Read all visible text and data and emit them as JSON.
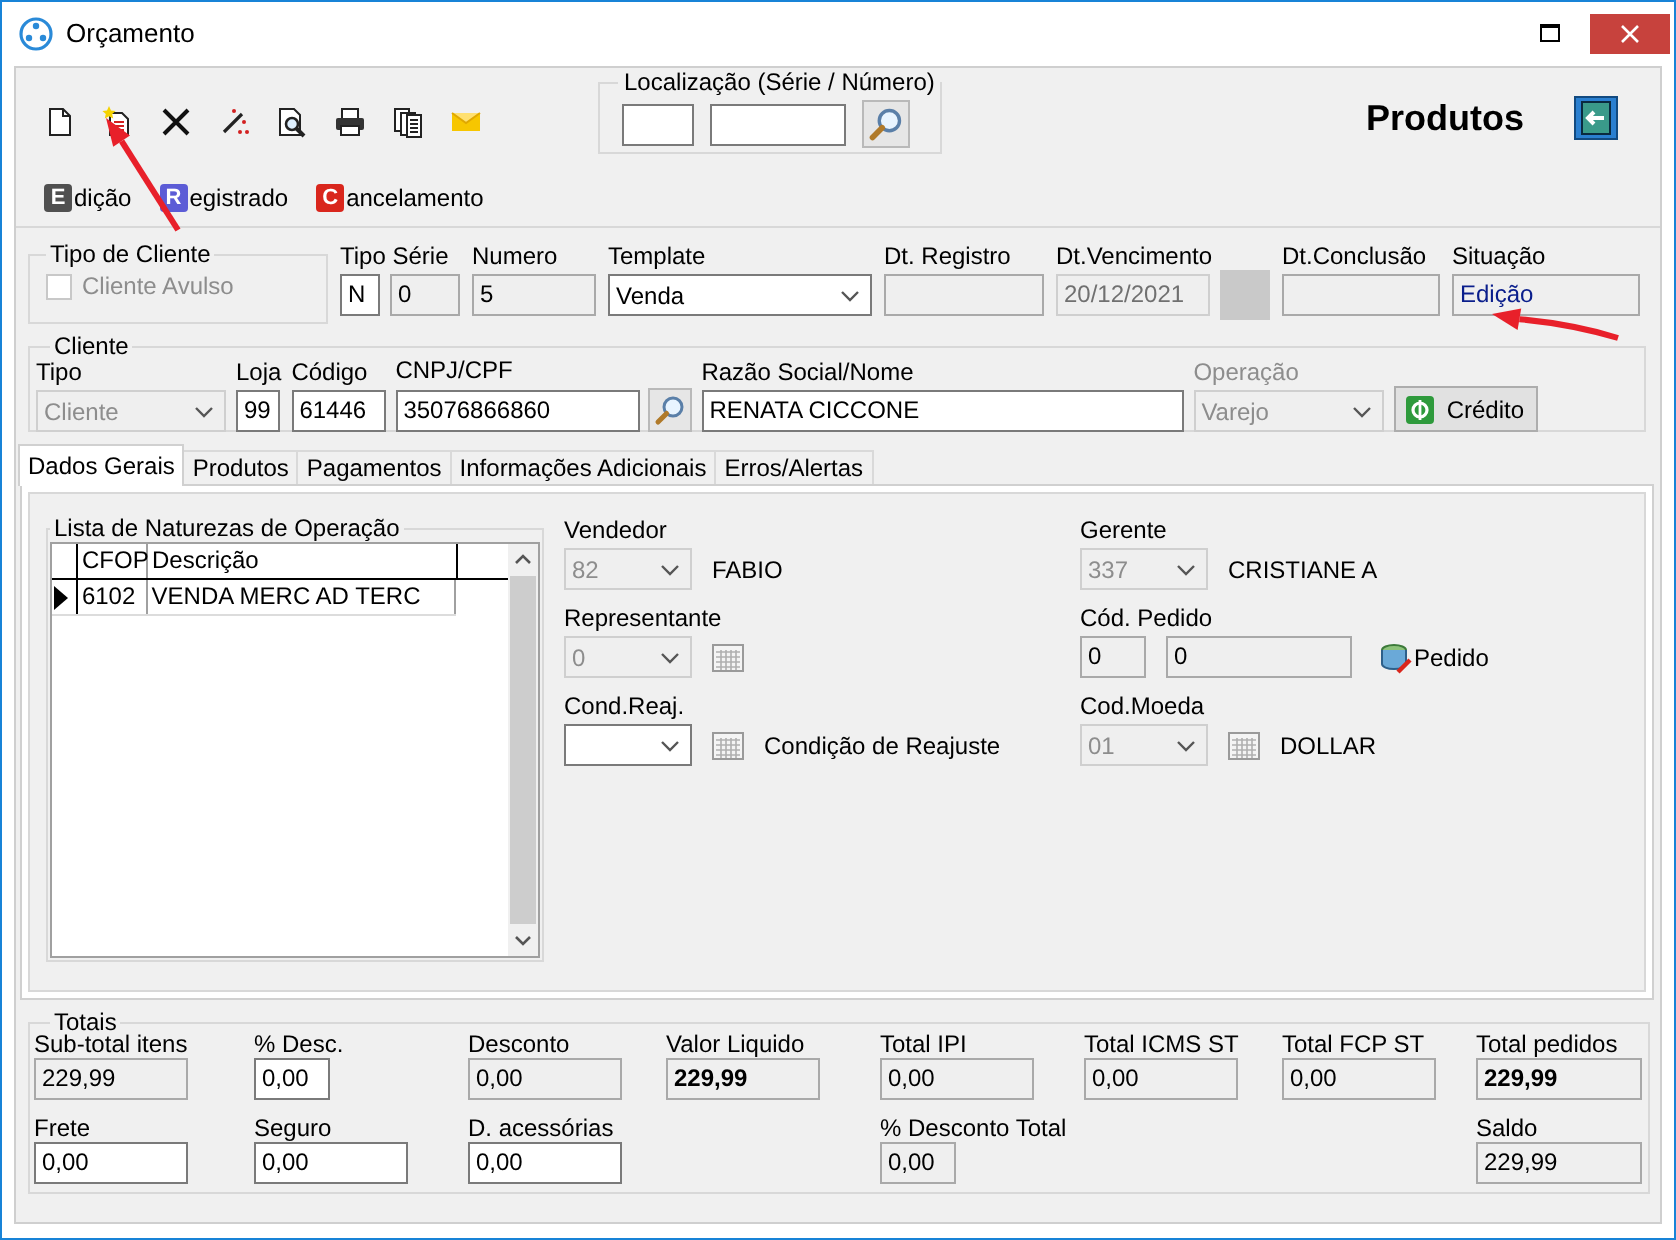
{
  "window": {
    "title": "Orçamento"
  },
  "toolbar": {
    "locator": {
      "title": "Localização (Série / Número)"
    },
    "heading": "Produtos"
  },
  "status_options": [
    {
      "letter": "E",
      "label": "dição",
      "color": "#505050"
    },
    {
      "letter": "R",
      "label": "egistrado",
      "color": "#5c5cd6"
    },
    {
      "letter": "C",
      "label": "ancelamento",
      "color": "#d9261c"
    }
  ],
  "client_type": {
    "title": "Tipo de Cliente",
    "checkbox": {
      "label": "Cliente Avulso",
      "checked": false,
      "disabled": true
    }
  },
  "header_fields": [
    {
      "label": "Tipo Série",
      "controls": [
        {
          "kind": "input",
          "value": "N",
          "readonly": false,
          "disabled": false
        },
        {
          "kind": "input",
          "value": "0",
          "readonly": true,
          "disabled": false
        }
      ]
    },
    {
      "label": "Numero",
      "controls": [
        {
          "kind": "input",
          "value": "5",
          "readonly": true,
          "disabled": false
        }
      ]
    },
    {
      "label": "Template",
      "controls": [
        {
          "kind": "select",
          "value": "Venda",
          "disabled": false
        }
      ]
    },
    {
      "label": "Dt. Registro",
      "controls": [
        {
          "kind": "input",
          "readonly": true,
          "disabled": false
        }
      ]
    },
    {
      "label": "Dt.Vencimento",
      "controls": [
        {
          "kind": "input",
          "value": "20/12/2021",
          "disabled": true
        },
        {
          "kind": "swatch"
        }
      ]
    },
    {
      "label": "Dt.Conclusão",
      "controls": [
        {
          "kind": "input",
          "readonly": true,
          "disabled": false
        }
      ]
    },
    {
      "label": "Situação",
      "controls": [
        {
          "kind": "status",
          "value": "Edição",
          "readonly": true,
          "disabled": false
        }
      ]
    }
  ],
  "client": {
    "title": "Cliente",
    "fields": [
      {
        "label": "Tipo",
        "label_disabled": false,
        "controls": [
          {
            "kind": "select",
            "value": "Cliente",
            "disabled": true
          }
        ]
      },
      {
        "label": "Loja",
        "label_disabled": false,
        "controls": [
          {
            "kind": "input",
            "value": "99",
            "readonly": false,
            "disabled": false
          }
        ]
      },
      {
        "label": "Código",
        "label_disabled": false,
        "controls": [
          {
            "kind": "input",
            "value": "61446",
            "readonly": false,
            "disabled": false
          }
        ]
      },
      {
        "label": "CNPJ/CPF",
        "label_disabled": false,
        "controls": [
          {
            "kind": "input",
            "value": "35076866860",
            "readonly": false,
            "disabled": false
          },
          {
            "kind": "search"
          }
        ]
      },
      {
        "label": "Razão Social/Nome",
        "label_disabled": false,
        "controls": [
          {
            "kind": "input",
            "value": "RENATA CICCONE",
            "readonly": false,
            "disabled": false
          }
        ]
      },
      {
        "label": "Operação",
        "label_disabled": true,
        "controls": [
          {
            "kind": "select",
            "value": "Varejo",
            "disabled": true
          }
        ]
      },
      {
        "controls": [
          {
            "kind": "credit",
            "value": "Crédito"
          }
        ]
      }
    ]
  },
  "tabs": [
    {
      "label": "Dados Gerais",
      "selected": true
    },
    {
      "label": "Produtos",
      "selected": false
    },
    {
      "label": "Pagamentos",
      "selected": false
    },
    {
      "label": "Informações Adicionais",
      "selected": false
    },
    {
      "label": "Erros/Alertas",
      "selected": false
    }
  ],
  "operations": {
    "title": "Lista de Naturezas de Operação",
    "columns": [
      "CFOP",
      "Descrição"
    ],
    "rows": [
      {
        "cells": [
          "6102",
          "VENDA MERC AD TERC"
        ],
        "selected": true
      }
    ]
  },
  "details": [
    [
      {
        "label": "Vendedor",
        "controls": [
          {
            "kind": "select",
            "value": "82",
            "disabled": true
          },
          {
            "kind": "text",
            "value": "FABIO"
          }
        ]
      },
      {
        "label": "Representante",
        "controls": [
          {
            "kind": "select",
            "value": "0",
            "disabled": true
          },
          {
            "kind": "lookup"
          }
        ]
      },
      {
        "label": "Cond.Reaj.",
        "controls": [
          {
            "kind": "select",
            "disabled": false
          },
          {
            "kind": "lookup"
          },
          {
            "kind": "text",
            "value": "Condição de Reajuste"
          }
        ]
      }
    ],
    [
      {
        "label": "Gerente",
        "controls": [
          {
            "kind": "select",
            "value": "337",
            "disabled": true
          },
          {
            "kind": "text",
            "value": "CRISTIANE A"
          }
        ]
      },
      {
        "label": "Cód. Pedido",
        "controls": [
          {
            "kind": "input",
            "value": "0",
            "readonly": true,
            "disabled": false
          },
          {
            "kind": "input",
            "value": "0",
            "readonly": true,
            "disabled": false
          },
          {
            "kind": "order",
            "value": "Pedido"
          }
        ]
      },
      {
        "label": "Cod.Moeda",
        "controls": [
          {
            "kind": "select",
            "value": "01",
            "disabled": true
          },
          {
            "kind": "lookup"
          },
          {
            "kind": "text",
            "value": "DOLLAR"
          }
        ]
      }
    ]
  ],
  "totals": {
    "title": "Totais",
    "columns": [
      [
        {
          "label": "Sub-total itens",
          "value": "229,99",
          "kind": "amount",
          "readonly": true,
          "bold": false
        },
        {
          "label": "Frete",
          "value": "0,00",
          "kind": "amount",
          "readonly": false,
          "bold": false
        }
      ],
      [
        {
          "label": "% Desc.",
          "value": "0,00",
          "kind": "percent",
          "readonly": false,
          "bold": false
        },
        {
          "label": "Seguro",
          "value": "0,00",
          "kind": "amount",
          "readonly": false,
          "bold": false
        }
      ],
      [
        {
          "label": "Desconto",
          "value": "0,00",
          "kind": "amount",
          "readonly": true,
          "bold": false
        },
        {
          "label": "D. acessórias",
          "value": "0,00",
          "kind": "amount",
          "readonly": false,
          "bold": false
        }
      ],
      [
        {
          "label": "Valor Liquido",
          "value": "229,99",
          "kind": "amount",
          "readonly": true,
          "bold": true
        }
      ],
      [
        {
          "label": "Total IPI",
          "value": "0,00",
          "kind": "amount",
          "readonly": true,
          "bold": false
        },
        {
          "label": "% Desconto Total",
          "value": "0,00",
          "kind": "percent",
          "readonly": true,
          "bold": false
        }
      ],
      [
        {
          "label": "Total ICMS ST",
          "value": "0,00",
          "kind": "amount",
          "readonly": true,
          "bold": false
        }
      ],
      [
        {
          "label": "Total FCP ST",
          "value": "0,00",
          "kind": "amount",
          "readonly": true,
          "bold": false
        }
      ],
      [
        {
          "label": "Total pedidos",
          "value": "229,99",
          "kind": "amount",
          "readonly": true,
          "bold": true
        },
        {
          "label": "Saldo",
          "value": "229,99",
          "kind": "amount",
          "readonly": true,
          "bold": false
        }
      ]
    ]
  }
}
